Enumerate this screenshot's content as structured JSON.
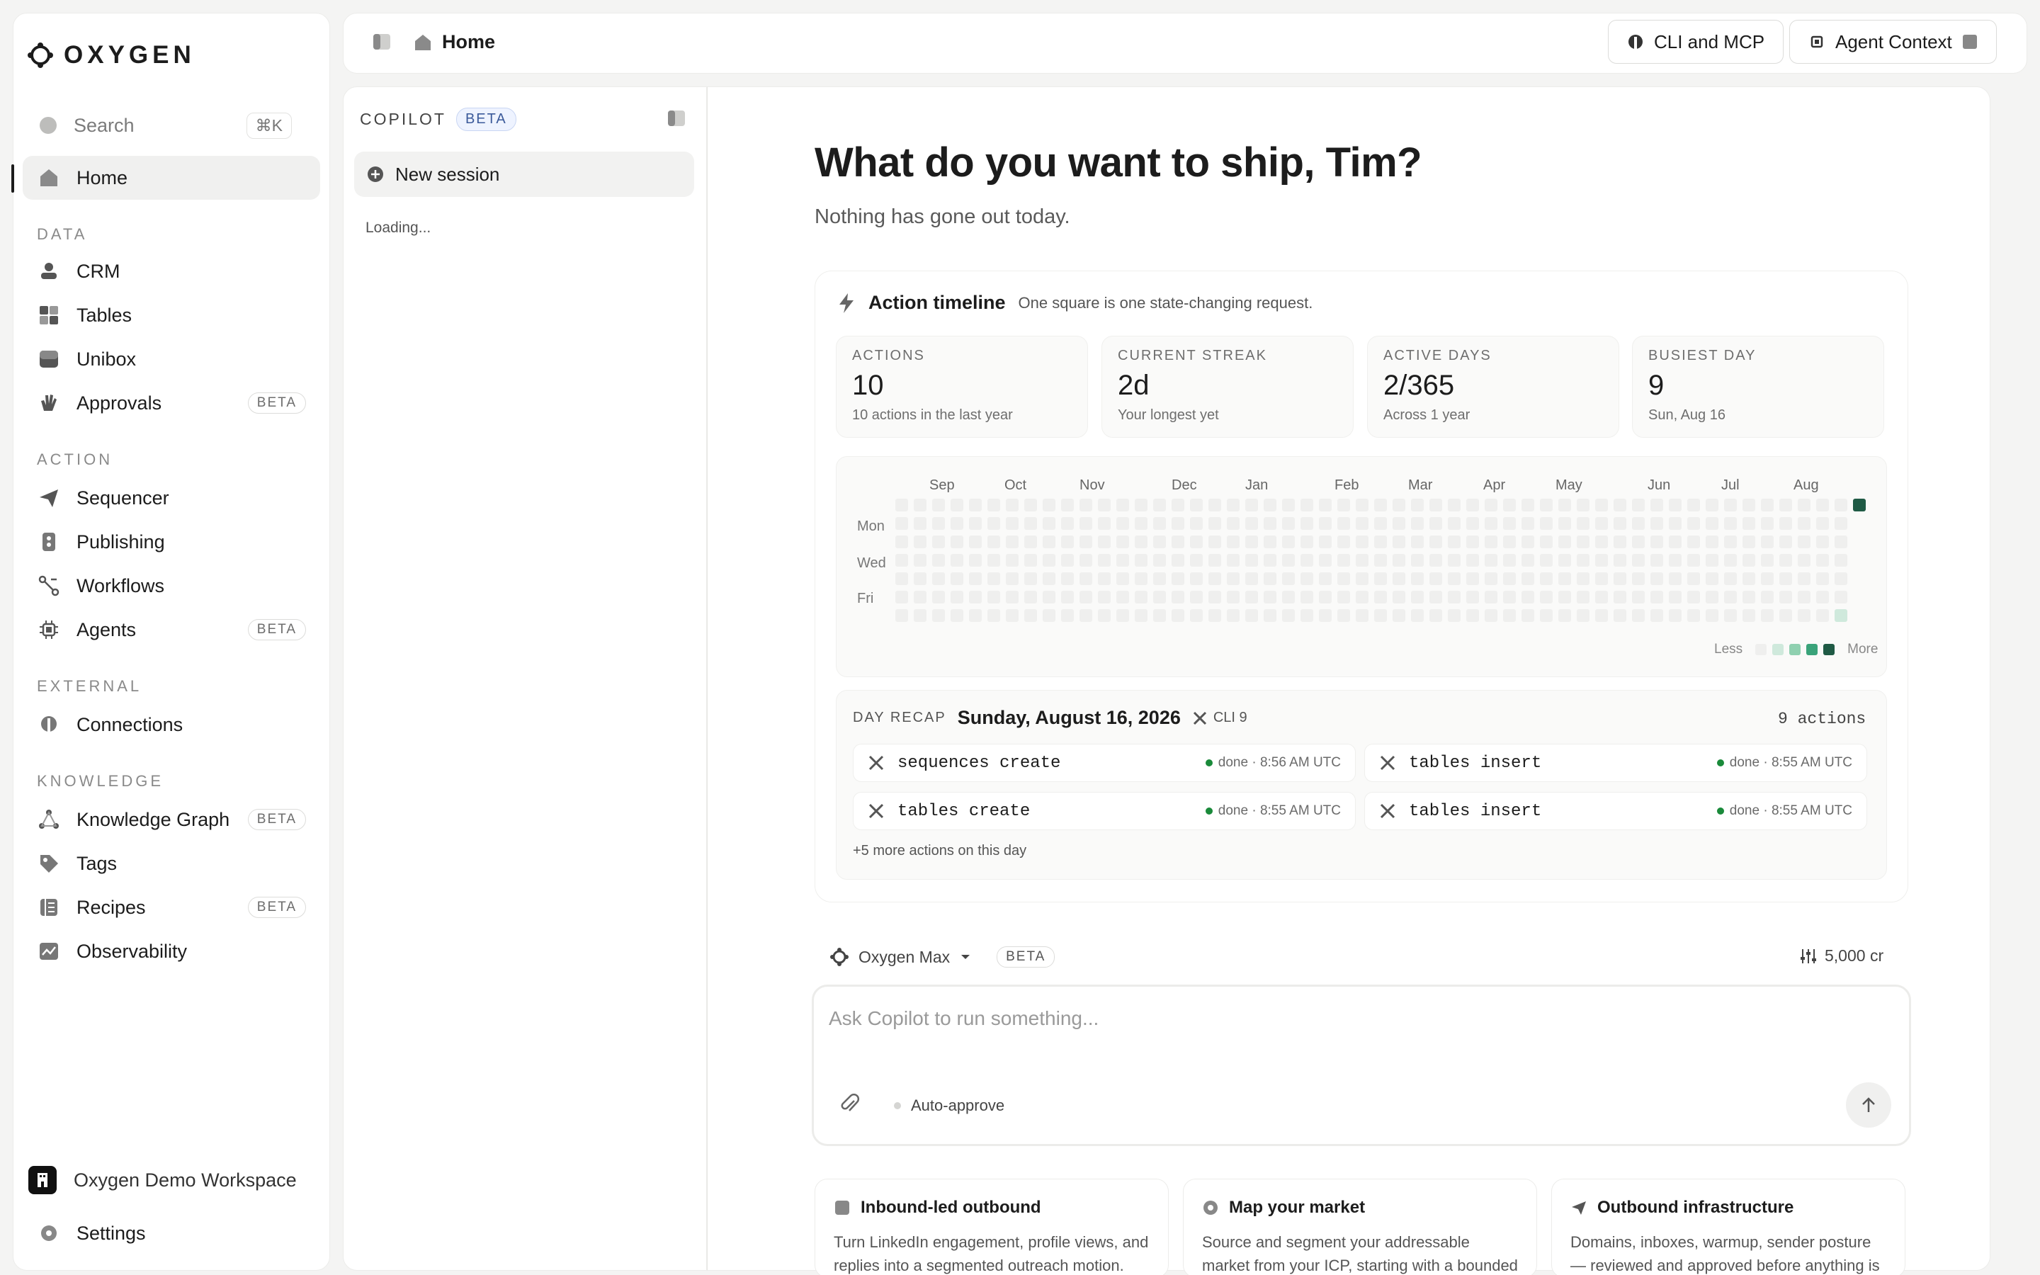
{
  "app": {
    "name": "OXYGEN"
  },
  "sidebar": {
    "search": {
      "label": "Search",
      "shortcut": "⌘K"
    },
    "home": "Home",
    "sections": {
      "data": "DATA",
      "action": "ACTION",
      "external": "EXTERNAL",
      "knowledge": "KNOWLEDGE"
    },
    "items": {
      "crm": "CRM",
      "tables": "Tables",
      "unibox": "Unibox",
      "approvals": "Approvals",
      "sequencer": "Sequencer",
      "publishing": "Publishing",
      "workflows": "Workflows",
      "agents": "Agents",
      "connections": "Connections",
      "knowledge_graph": "Knowledge Graph",
      "tags": "Tags",
      "recipes": "Recipes",
      "observability": "Observability"
    },
    "beta": "BETA",
    "workspace": "Oxygen Demo Workspace",
    "settings": "Settings"
  },
  "topbar": {
    "breadcrumb": "Home",
    "cli_button": "CLI and MCP",
    "agent_button": "Agent Context"
  },
  "copilot": {
    "title": "COPILOT",
    "beta": "BETA",
    "new_session": "New session",
    "loading": "Loading..."
  },
  "main": {
    "greeting": "What do you want to ship, Tim?",
    "subtitle": "Nothing has gone out today.",
    "timeline": {
      "title": "Action timeline",
      "caption": "One square is one state-changing request.",
      "stats": [
        {
          "label": "ACTIONS",
          "value": "10",
          "note": "10 actions in the last year"
        },
        {
          "label": "CURRENT STREAK",
          "value": "2d",
          "note": "Your longest yet"
        },
        {
          "label": "ACTIVE DAYS",
          "value": "2/365",
          "note": "Across 1 year"
        },
        {
          "label": "BUSIEST DAY",
          "value": "9",
          "note": "Sun, Aug 16"
        }
      ],
      "months": [
        "Sep",
        "Oct",
        "Nov",
        "Dec",
        "Jan",
        "Feb",
        "Mar",
        "Apr",
        "May",
        "Jun",
        "Jul",
        "Aug"
      ],
      "days": [
        "Mon",
        "Wed",
        "Fri"
      ],
      "legend_less": "Less",
      "legend_more": "More",
      "colors": {
        "empty": "#efefee",
        "l1": "#cfe9dc",
        "l2": "#8fd0b0",
        "l3": "#3aa37a",
        "l4": "#1f5a45"
      }
    },
    "recap": {
      "label": "DAY RECAP",
      "date": "Sunday, August 16, 2026",
      "source": "CLI 9",
      "count": "9 actions",
      "rows": [
        {
          "cmd": "sequences create",
          "status": "done · 8:56 AM UTC"
        },
        {
          "cmd": "tables insert",
          "status": "done · 8:55 AM UTC"
        },
        {
          "cmd": "tables create",
          "status": "done · 8:55 AM UTC"
        },
        {
          "cmd": "tables insert",
          "status": "done · 8:55 AM UTC"
        }
      ],
      "more": "+5 more actions on this day"
    },
    "composer": {
      "model": "Oxygen Max",
      "beta": "BETA",
      "credits": "5,000 cr",
      "placeholder": "Ask Copilot to run something...",
      "auto_approve": "Auto-approve"
    },
    "suggestions": [
      {
        "title": "Inbound-led outbound",
        "desc": "Turn LinkedIn engagement, profile views, and replies into a segmented outreach motion."
      },
      {
        "title": "Map your market",
        "desc": "Source and segment your addressable market from your ICP, starting with a bounded"
      },
      {
        "title": "Outbound infrastructure",
        "desc": "Domains, inboxes, warmup, sender posture — reviewed and approved before anything is"
      }
    ]
  }
}
